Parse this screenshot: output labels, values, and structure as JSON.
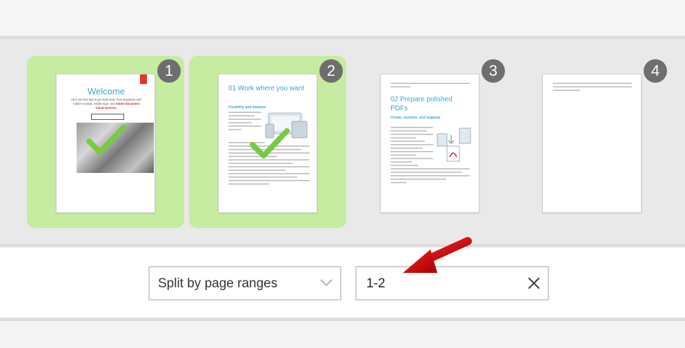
{
  "pages": [
    {
      "number": "1",
      "selected": true,
      "title": "Welcome",
      "intro": "Here are four tips to get work done from anywhere with Adobe Acrobat, Adobe Sign, and",
      "intro_red": "Adobe Document Cloud services."
    },
    {
      "number": "2",
      "selected": true,
      "heading_num": "01",
      "heading": "Work where you want",
      "subheading": "Flexibility and freedom"
    },
    {
      "number": "3",
      "selected": false,
      "heading_num": "02",
      "heading": "Prepare polished PDFs",
      "subheading": "Create, combine, and organize"
    },
    {
      "number": "4",
      "selected": false
    }
  ],
  "controls": {
    "split_mode": "Split by page ranges",
    "range_value": "1-2"
  },
  "colors": {
    "selected_card": "#c6eca1",
    "badge": "#6e6e6e",
    "accent": "#3aa5d8",
    "arrow": "#cc1111",
    "check": "#7ac943"
  },
  "icons": {
    "dropdown": "chevron-down-icon",
    "clear": "close-icon",
    "annotation": "red-arrow-icon",
    "selection": "checkmark-icon"
  }
}
